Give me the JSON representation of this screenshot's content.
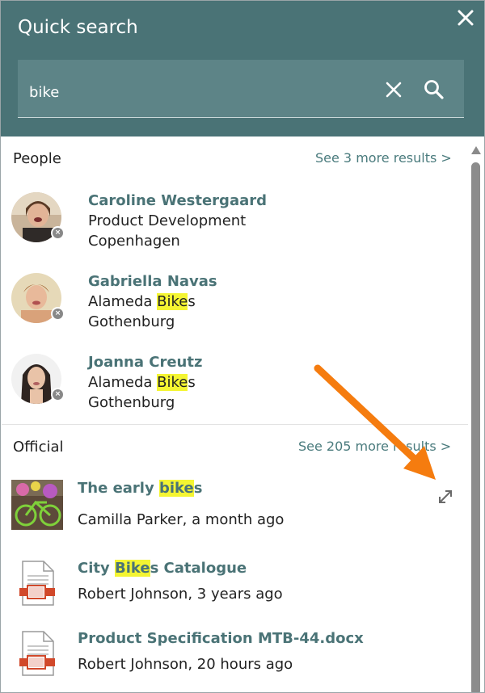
{
  "header": {
    "title": "Quick search",
    "close_icon": "close-icon"
  },
  "search": {
    "value": "bike",
    "clear_icon": "clear-icon",
    "search_icon": "search-icon"
  },
  "people": {
    "title": "People",
    "see_more": "See 3 more results >",
    "items": [
      {
        "name": "Caroline Westergaard",
        "line1": "Product Development",
        "line2": "Copenhagen",
        "status_icon": "offline-status-icon"
      },
      {
        "name": "Gabriella Navas",
        "line1_prefix": "Alameda ",
        "line1_highlight": "Bike",
        "line1_suffix": "s",
        "line2": "Gothenburg",
        "status_icon": "offline-status-icon"
      },
      {
        "name": "Joanna Creutz",
        "line1_prefix": "Alameda ",
        "line1_highlight": "Bike",
        "line1_suffix": "s",
        "line2": "Gothenburg",
        "status_icon": "offline-status-icon"
      }
    ]
  },
  "official": {
    "title": "Official",
    "see_more": "See 205 more results >",
    "items": [
      {
        "title_prefix": "The early ",
        "title_highlight": "bike",
        "title_suffix": "s",
        "meta": "Camilla Parker, a month ago",
        "thumb_icon": "bike-photo-thumbnail",
        "action_icon": "expand-icon"
      },
      {
        "title_prefix": "City ",
        "title_highlight": "Bike",
        "title_suffix": "s Catalogue",
        "meta": "Robert Johnson, 3 years ago",
        "thumb_icon": "document-icon"
      },
      {
        "title": "Product Specification MTB-44.docx",
        "meta": "Robert Johnson, 20 hours ago",
        "thumb_icon": "document-icon"
      }
    ]
  },
  "colors": {
    "header_bg": "#4a7376",
    "search_bg": "#5d8487",
    "link": "#4a7b7d",
    "highlight": "#f4f532",
    "annotation_arrow": "#f57c0f"
  }
}
